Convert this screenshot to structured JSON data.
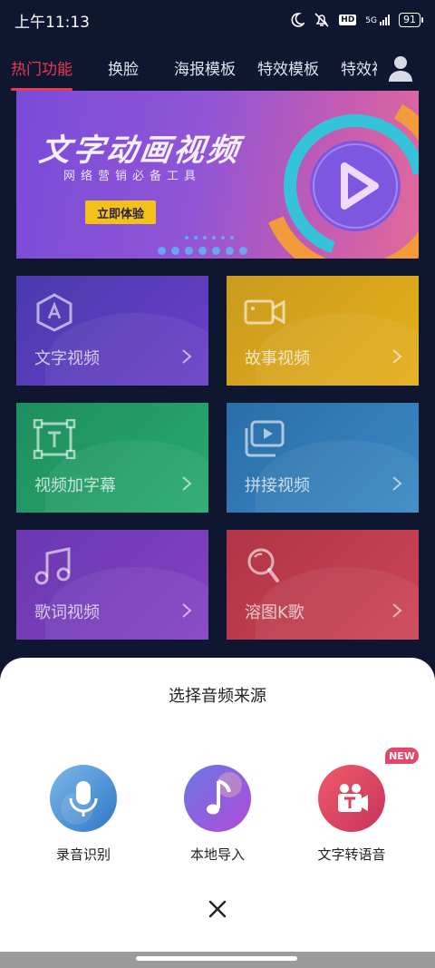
{
  "status_bar": {
    "time": "上午11:13",
    "hd": "HD",
    "signal": "5G",
    "battery": "91"
  },
  "tabs": [
    {
      "label": "热门功能",
      "active": true
    },
    {
      "label": "换脸"
    },
    {
      "label": "海报模板"
    },
    {
      "label": "特效模板"
    },
    {
      "label": "特效视"
    }
  ],
  "banner": {
    "title": "文字动画视频",
    "subtitle": "网络营销必备工具",
    "cta": "立即体验"
  },
  "cards": [
    {
      "label": "文字视频",
      "icon": "text-a-icon",
      "color": "#5b3bc9"
    },
    {
      "label": "故事视频",
      "icon": "video-camera-icon",
      "color": "#e0a61c"
    },
    {
      "label": "视频加字幕",
      "icon": "subtitle-t-icon",
      "color": "#21a36b"
    },
    {
      "label": "拼接视频",
      "icon": "stacked-play-icon",
      "color": "#2f7fb7"
    },
    {
      "label": "歌词视频",
      "icon": "music-note-icon",
      "color": "#7a3dbb"
    },
    {
      "label": "溶图K歌",
      "icon": "karaoke-mic-icon",
      "color": "#c63d4d"
    }
  ],
  "sheet": {
    "title": "选择音频来源",
    "options": [
      {
        "label": "录音识别",
        "icon": "microphone-icon"
      },
      {
        "label": "本地导入",
        "icon": "music-note-icon"
      },
      {
        "label": "文字转语音",
        "icon": "text-video-icon"
      }
    ],
    "new_badge": "NEW"
  },
  "colors": {
    "background": "#0e1630",
    "accent": "#e63a52",
    "cta": "#f2c21b"
  }
}
